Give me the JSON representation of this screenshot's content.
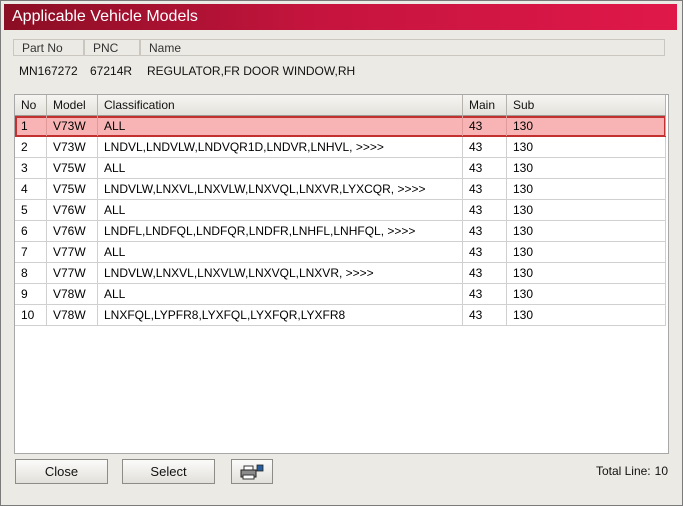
{
  "window": {
    "title": "Applicable Vehicle Models"
  },
  "part": {
    "headers": {
      "part_no": "Part No",
      "pnc": "PNC",
      "name": "Name"
    },
    "values": {
      "part_no": "MN167272",
      "pnc": "67214R",
      "name": "REGULATOR,FR DOOR WINDOW,RH"
    }
  },
  "grid": {
    "headers": {
      "no": "No",
      "model": "Model",
      "classification": "Classification",
      "main": "Main",
      "sub": "Sub"
    },
    "rows": [
      {
        "no": "1",
        "model": "V73W",
        "classification": "ALL",
        "main": "43",
        "sub": "130"
      },
      {
        "no": "2",
        "model": "V73W",
        "classification": "LNDVL,LNDVLW,LNDVQR1D,LNDVR,LNHVL,  >>>>",
        "main": "43",
        "sub": "130"
      },
      {
        "no": "3",
        "model": "V75W",
        "classification": "ALL",
        "main": "43",
        "sub": "130"
      },
      {
        "no": "4",
        "model": "V75W",
        "classification": "LNDVLW,LNXVL,LNXVLW,LNXVQL,LNXVR,LYXCQR,  >>>>",
        "main": "43",
        "sub": "130"
      },
      {
        "no": "5",
        "model": "V76W",
        "classification": "ALL",
        "main": "43",
        "sub": "130"
      },
      {
        "no": "6",
        "model": "V76W",
        "classification": "LNDFL,LNDFQL,LNDFQR,LNDFR,LNHFL,LNHFQL,  >>>>",
        "main": "43",
        "sub": "130"
      },
      {
        "no": "7",
        "model": "V77W",
        "classification": "ALL",
        "main": "43",
        "sub": "130"
      },
      {
        "no": "8",
        "model": "V77W",
        "classification": "LNDVLW,LNXVL,LNXVLW,LNXVQL,LNXVR,  >>>>",
        "main": "43",
        "sub": "130"
      },
      {
        "no": "9",
        "model": "V78W",
        "classification": "ALL",
        "main": "43",
        "sub": "130"
      },
      {
        "no": "10",
        "model": "V78W",
        "classification": "LNXFQL,LYPFR8,LYXFQL,LYXFQR,LYXFR8",
        "main": "43",
        "sub": "130"
      }
    ],
    "selected_row": 1
  },
  "buttons": {
    "close": "Close",
    "select": "Select",
    "print_icon": "printer-icon"
  },
  "footer": {
    "total_label": "Total Line:",
    "total_value": "10"
  },
  "colors": {
    "title_start": "#8a0e24",
    "title_end": "#e0184a",
    "selection_fill": "#f8b4b4",
    "selection_border": "#c23030"
  }
}
